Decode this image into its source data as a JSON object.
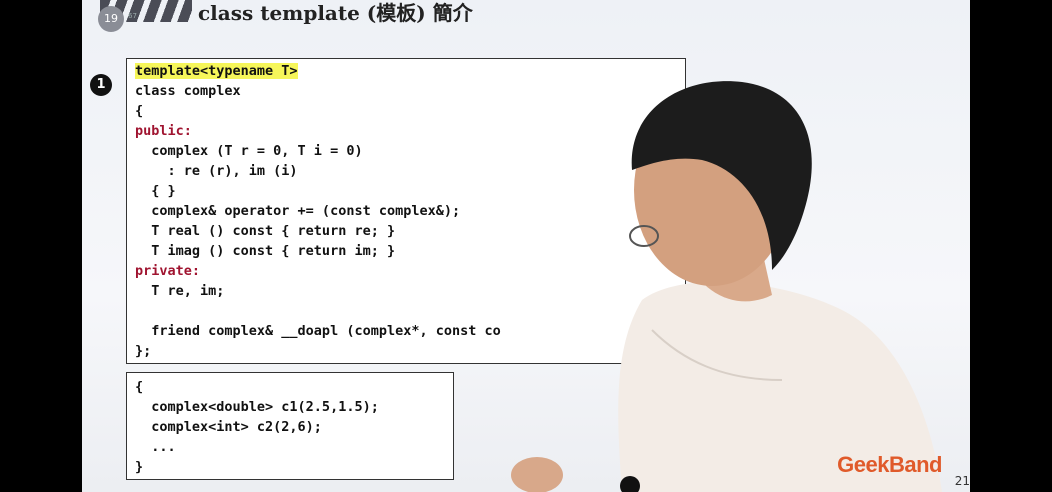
{
  "header": {
    "title": "class template (模板) 簡介",
    "page_badge": "19",
    "page_small": "67"
  },
  "marker": "1",
  "code_box1": {
    "lines": [
      "template<typename T>",
      "class complex",
      "{",
      "public:",
      "  complex (T r = 0, T i = 0)",
      "    : re (r), im (i)",
      "  { }",
      "  complex& operator += (const complex&);",
      "  T real () const { return re; }",
      "  T imag () const { return im; }",
      "private:",
      "  T re, im;",
      "",
      "  friend complex& __doapl (complex*, const co",
      "};"
    ]
  },
  "code_box2": {
    "lines": [
      "{",
      "  complex<double> c1(2.5,1.5);",
      "  complex<int> c2(2,6);",
      "  ...",
      "}"
    ]
  },
  "brand": "GeekBand",
  "slide_number": "21",
  "colors": {
    "highlight": "#f6f65a",
    "keyword_red": "#a01430",
    "keyword_blue": "#2020b0",
    "member_green": "#1c8a2a",
    "brand": "#e05a2a"
  }
}
